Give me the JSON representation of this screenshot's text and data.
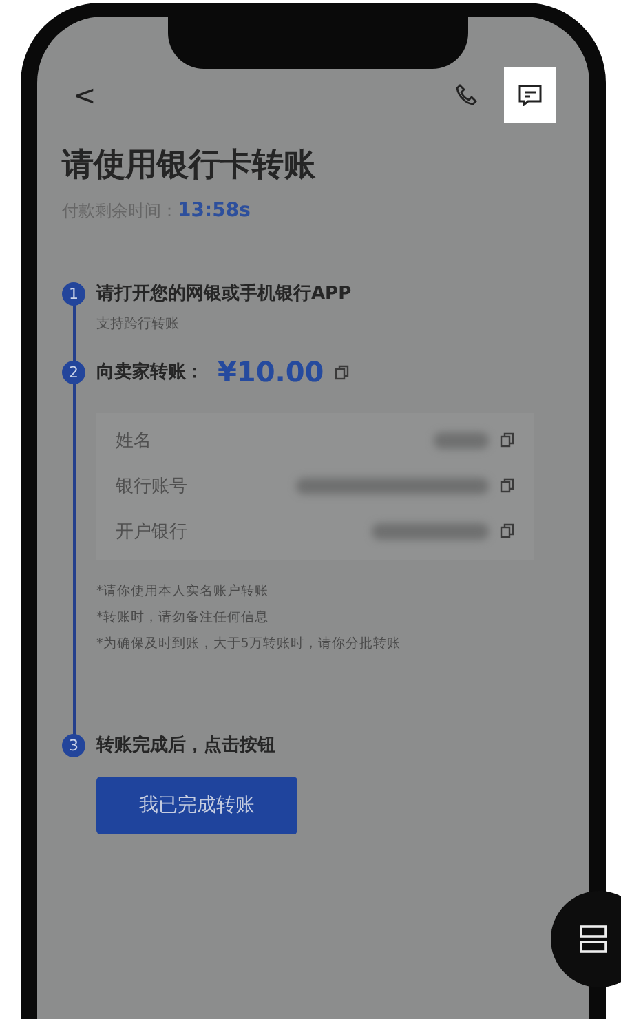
{
  "header": {
    "back": "<"
  },
  "title": "请使用银行卡转账",
  "timer": {
    "label": "付款剩余时间：",
    "value": "13:58s"
  },
  "steps": [
    {
      "number": "1",
      "text": "请打开您的网银或手机银行APP",
      "note": "支持跨行转账"
    },
    {
      "number": "2",
      "text": "向卖家转账：",
      "amount": "¥10.00"
    },
    {
      "number": "3",
      "text": "转账完成后，点击按钮"
    }
  ],
  "payee_fields": [
    {
      "label": "姓名"
    },
    {
      "label": "银行账号"
    },
    {
      "label": "开户银行"
    }
  ],
  "notes": [
    "*请你使用本人实名账户转账",
    "*转账时，请勿备注任何信息",
    "*为确保及时到账，大于5万转账时，请你分批转账"
  ],
  "confirm_button": "我已完成转账"
}
